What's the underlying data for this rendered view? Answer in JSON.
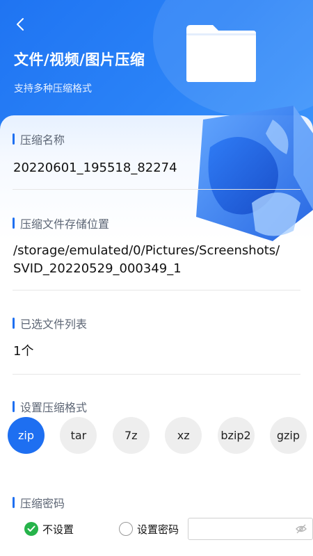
{
  "header": {
    "title": "文件/视频/图片压缩",
    "subtitle": "支持多种压缩格式"
  },
  "fields": {
    "name_label": "压缩名称",
    "name_value": "20220601_195518_82274",
    "path_label": "压缩文件存储位置",
    "path_value_line1": "/storage/emulated/0/Pictures/Screenshots/",
    "path_value_line2": "SVID_20220529_000349_1",
    "files_label": "已选文件列表",
    "files_value": "1个"
  },
  "format": {
    "label": "设置压缩格式",
    "options": [
      "zip",
      "tar",
      "7z",
      "xz",
      "bzip2",
      "gzip"
    ],
    "selected": "zip"
  },
  "password": {
    "label": "压缩密码",
    "option_none": "不设置",
    "option_set": "设置密码",
    "selected": "不设置",
    "input_value": ""
  },
  "colors": {
    "accent": "#1e6ff1",
    "header_bg": "#2a82f7",
    "check_green": "#26b34a"
  },
  "icons": {
    "back": "chevron-left-icon",
    "folder": "folder-icon",
    "cube": "cube-illustration",
    "eye": "eye-off-icon",
    "check": "check-icon"
  }
}
